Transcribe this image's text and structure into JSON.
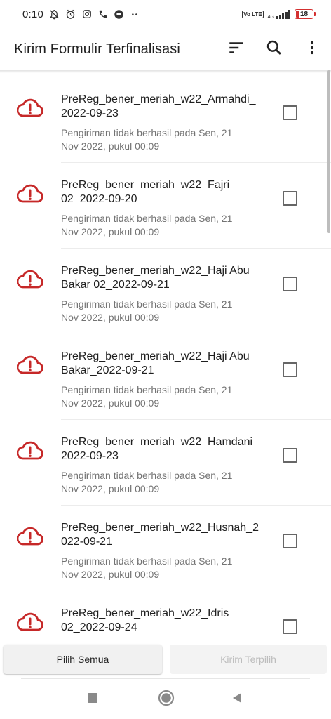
{
  "status_bar": {
    "time": "0:10",
    "network": "4G",
    "volte": "Vo LTE",
    "battery": "18"
  },
  "app_bar": {
    "title": "Kirim Formulir Terfinalisasi",
    "icons": [
      "sort-icon",
      "search-icon",
      "more-vert-icon"
    ]
  },
  "accent_color": "#c62828",
  "forms": [
    {
      "name": "PreReg_bener_meriah_w22_Armahdi_\n2022-09-23",
      "status": "Pengiriman tidak berhasil pada Sen, 21\nNov 2022, pukul 00:09",
      "checked": false
    },
    {
      "name": "PreReg_bener_meriah_w22_Fajri\n02_2022-09-20",
      "status": "Pengiriman tidak berhasil pada Sen, 21\nNov 2022, pukul 00:09",
      "checked": false
    },
    {
      "name": "PreReg_bener_meriah_w22_Haji Abu\nBakar 02_2022-09-21",
      "status": "Pengiriman tidak berhasil pada Sen, 21\nNov 2022, pukul 00:09",
      "checked": false
    },
    {
      "name": "PreReg_bener_meriah_w22_Haji Abu\nBakar_2022-09-21",
      "status": "Pengiriman tidak berhasil pada Sen, 21\nNov 2022, pukul 00:09",
      "checked": false
    },
    {
      "name": "PreReg_bener_meriah_w22_Hamdani_\n2022-09-23",
      "status": "Pengiriman tidak berhasil pada Sen, 21\nNov 2022, pukul 00:09",
      "checked": false
    },
    {
      "name": "PreReg_bener_meriah_w22_Husnah_2\n022-09-21",
      "status": "Pengiriman tidak berhasil pada Sen, 21\nNov 2022, pukul 00:09",
      "checked": false
    },
    {
      "name": "PreReg_bener_meriah_w22_Idris\n02_2022-09-24",
      "status": "",
      "checked": false
    }
  ],
  "bottom_bar": {
    "select_all_label": "Pilih Semua",
    "send_selected_label": "Kirim Terpilih"
  },
  "nav_bar": {
    "icons": [
      "recents-icon",
      "home-icon",
      "back-icon"
    ]
  }
}
